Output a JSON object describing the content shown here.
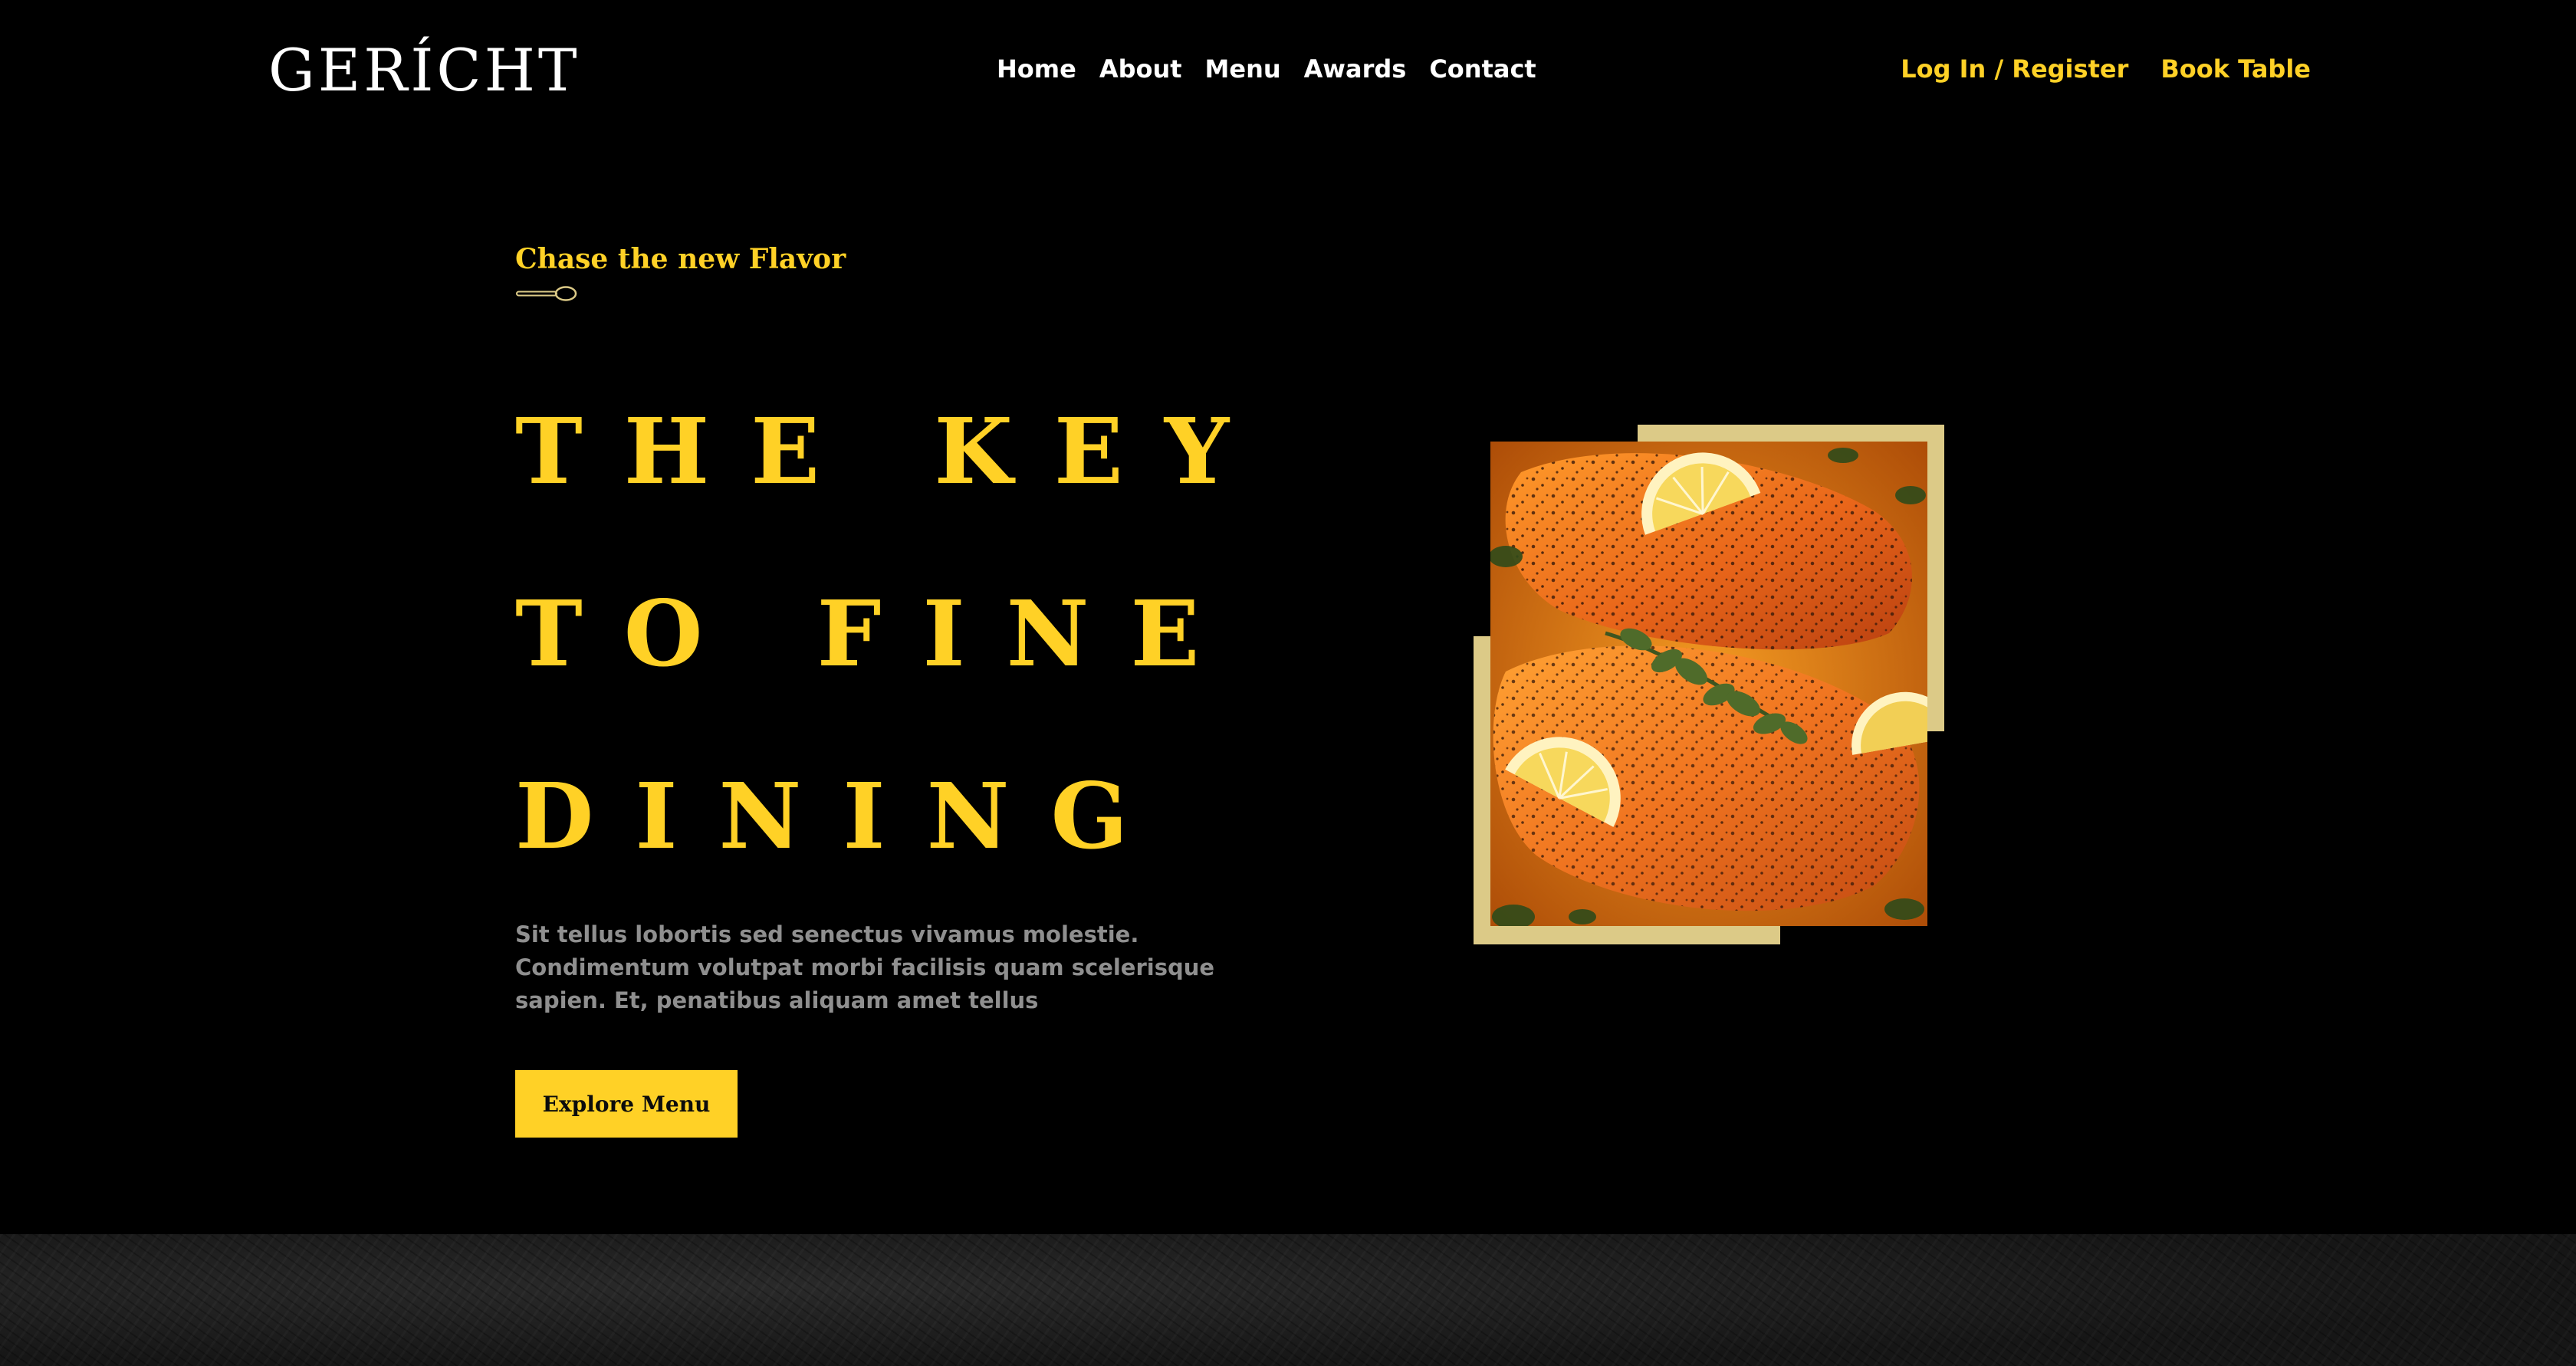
{
  "header": {
    "logo": "GERÍCHT",
    "nav": [
      "Home",
      "About",
      "Menu",
      "Awards",
      "Contact"
    ],
    "login_label": "Log In / Register",
    "book_label": "Book Table"
  },
  "hero": {
    "kicker": "Chase the new Flavor",
    "headline": [
      "THE KEY",
      "TO FINE",
      "DINING"
    ],
    "description": "Sit tellus lobortis sed senectus vivamus molestie. Condimentum volutpat morbi facilisis quam scelerisque sapien. Et, penatibus aliquam amet tellus",
    "cta_label": "Explore Menu",
    "image_icon": "salmon-dish-photo"
  },
  "colors": {
    "accent": "#ffd126",
    "frame": "#dcca87",
    "background": "#000000",
    "text_muted": "#8f8f8f"
  }
}
